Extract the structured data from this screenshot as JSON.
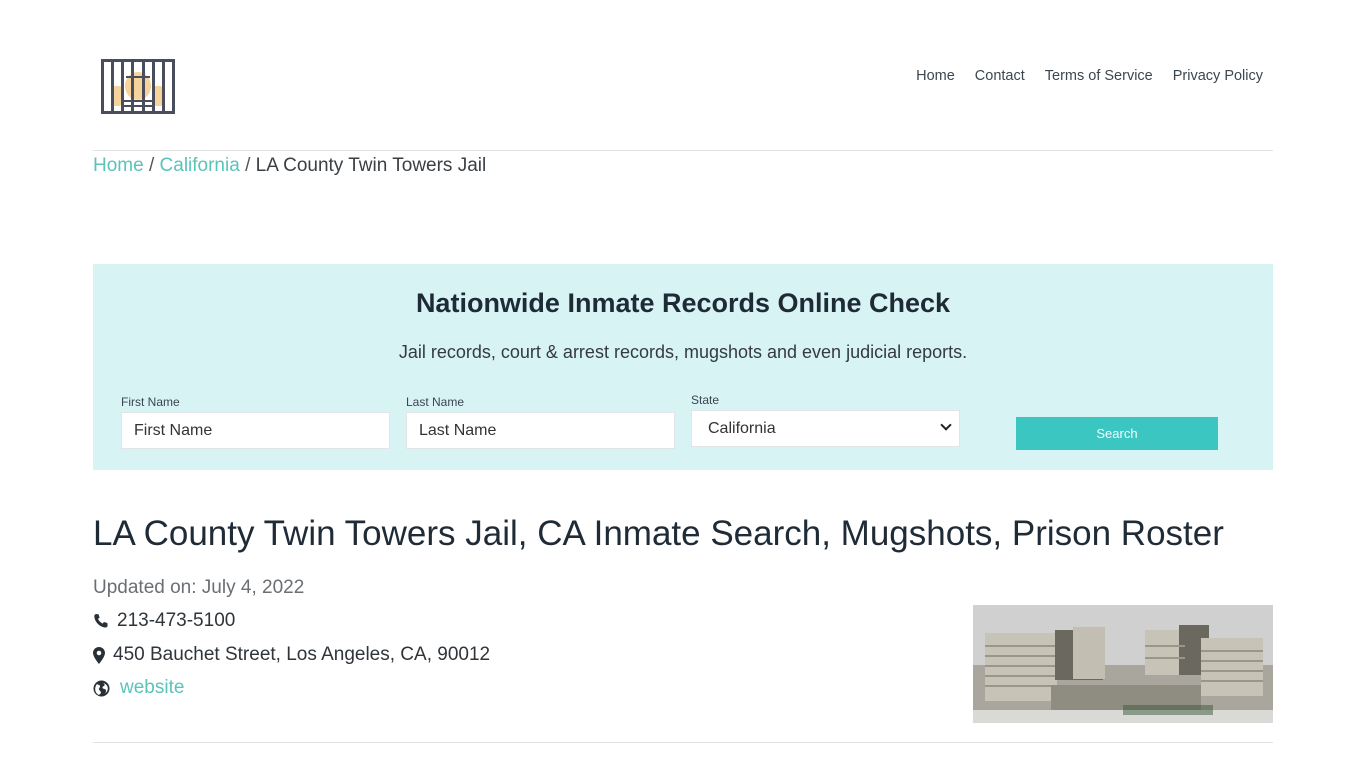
{
  "header": {
    "logo_icon": "jail-bars-icon",
    "nav": [
      "Home",
      "Contact",
      "Terms of Service",
      "Privacy Policy"
    ]
  },
  "breadcrumb": {
    "items": [
      "Home",
      "California"
    ],
    "current": "LA County Twin Towers Jail",
    "separator": "/"
  },
  "search": {
    "title": "Nationwide Inmate Records Online Check",
    "subtitle": "Jail records, court & arrest records, mugshots and even judicial reports.",
    "first_name_label": "First Name",
    "first_name_placeholder": "First Name",
    "last_name_label": "Last Name",
    "last_name_placeholder": "Last Name",
    "state_label": "State",
    "state_selected": "California",
    "button_label": "Search",
    "bg_color": "#d8f3f4",
    "button_color": "#3cc6c2"
  },
  "facility": {
    "title": "LA County Twin Towers Jail, CA Inmate Search, Mugshots, Prison Roster",
    "updated": "Updated on: July 4, 2022",
    "phone": "213-473-5100",
    "address": "450 Bauchet Street, Los Angeles, CA, 90012",
    "website_label": "website",
    "photo_alt": "LA County Twin Towers Jail building aerial photo"
  },
  "colors": {
    "accent": "#5cc3bb",
    "text_dark": "#1f2b36"
  }
}
